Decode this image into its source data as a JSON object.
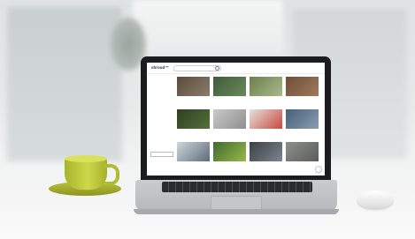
{
  "app": {
    "logo": "shroud™"
  },
  "search": {
    "placeholder": ""
  },
  "header_links": [
    "",
    ""
  ],
  "sidebar": {
    "items": [
      {
        "label": "",
        "icon": "home-icon"
      },
      {
        "label": "",
        "icon": "folder-icon"
      },
      {
        "label": "",
        "icon": "folder-icon"
      },
      {
        "label": "",
        "icon": "folder-icon"
      },
      {
        "label": "",
        "icon": "folder-icon"
      },
      {
        "label": "",
        "icon": "folder-icon"
      },
      {
        "label": "",
        "icon": "tag-icon"
      },
      {
        "label": "",
        "icon": "tag-icon"
      },
      {
        "label": "",
        "icon": "user-icon"
      },
      {
        "label": "",
        "icon": "user-icon"
      },
      {
        "label": "",
        "icon": "user-icon"
      }
    ],
    "button_label": ""
  },
  "videos": [
    {
      "title": "",
      "meta": "",
      "colors": [
        "#5b4a3c",
        "#8a7d6a"
      ]
    },
    {
      "title": "",
      "meta": "",
      "colors": [
        "#3f5b3a",
        "#6a8a5a"
      ]
    },
    {
      "title": "",
      "meta": "",
      "colors": [
        "#6b7f4f",
        "#a9b98a"
      ]
    },
    {
      "title": "",
      "meta": "",
      "colors": [
        "#6f4e3a",
        "#9e7b5c"
      ]
    },
    {
      "title": "",
      "meta": "",
      "colors": [
        "#2f3f22",
        "#55703a"
      ]
    },
    {
      "title": "",
      "meta": "",
      "colors": [
        "#c9c9c9",
        "#8f8f8f"
      ]
    },
    {
      "title": "",
      "meta": "",
      "colors": [
        "#e6e2de",
        "#c74a3f"
      ]
    },
    {
      "title": "",
      "meta": "",
      "colors": [
        "#46607a",
        "#8a9db0"
      ]
    },
    {
      "title": "",
      "meta": "",
      "colors": [
        "#cfd6dc",
        "#5c6c7a"
      ]
    },
    {
      "title": "",
      "meta": "",
      "colors": [
        "#3e6b2f",
        "#9ab84a"
      ]
    },
    {
      "title": "",
      "meta": "",
      "colors": [
        "#3b3f47",
        "#7d8590"
      ]
    },
    {
      "title": "",
      "meta": "",
      "colors": [
        "#8d8f8c",
        "#5a5c5a"
      ]
    }
  ],
  "colors": {
    "cup": "#b8c23a",
    "bezel": "#1b1c1e",
    "aluminum": "#c4c6c8"
  }
}
